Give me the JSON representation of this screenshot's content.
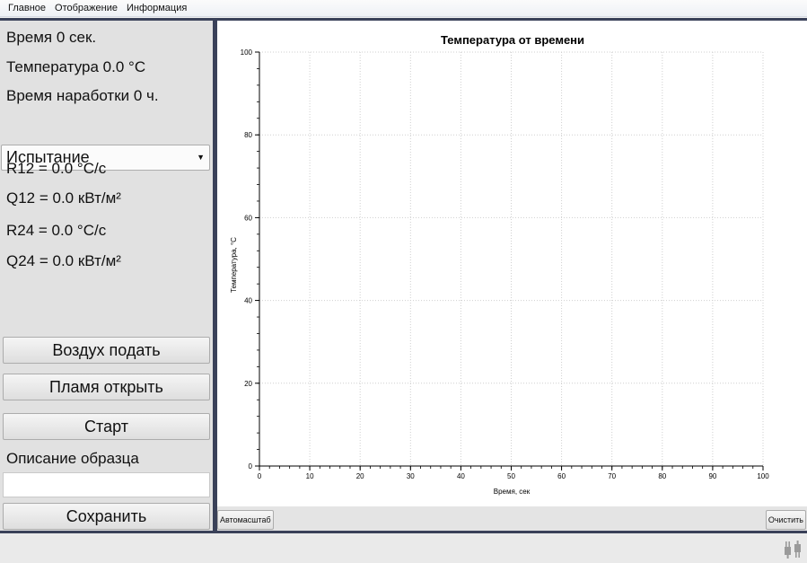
{
  "menu": [
    "Главное",
    "Отображение",
    "Информация"
  ],
  "left": {
    "time_line": "Время 0 сек.",
    "temp_line": "Температура 0.0 °C",
    "runtime_line": "Время наработки 0 ч.",
    "mode_select": "Испытание",
    "r12": "R12 = 0.0 °C/c",
    "q12": "Q12 = 0.0 кВт/м²",
    "r24": "R24 = 0.0 °C/c",
    "q24": "Q24 = 0.0 кВт/м²",
    "air_button": "Воздух подать",
    "flame_button": "Пламя открыть",
    "start_button": "Старт",
    "description_label": "Описание образца",
    "description_value": "",
    "save_button": "Сохранить"
  },
  "chart": {
    "autoscale_button": "Автомасштаб",
    "clear_button": "Очистить"
  },
  "chart_data": {
    "type": "line",
    "title": "Температура от времени",
    "xlabel": "Время, сек",
    "ylabel": "Температура, °C",
    "xlim": [
      0,
      100
    ],
    "ylim": [
      0,
      100
    ],
    "xticks": [
      "0",
      "10",
      "20",
      "30",
      "40",
      "50",
      "60",
      "70",
      "80",
      "90",
      "100"
    ],
    "yticks": [
      "0",
      "20",
      "40",
      "60",
      "80",
      "100"
    ],
    "grid": true,
    "series": [
      {
        "x": [],
        "y": []
      }
    ]
  },
  "colors": {
    "frame": "#3a4159",
    "panel": "#e1e1e1",
    "grid": "#c8c8c8"
  },
  "icons": {
    "status": "plug-icon"
  }
}
